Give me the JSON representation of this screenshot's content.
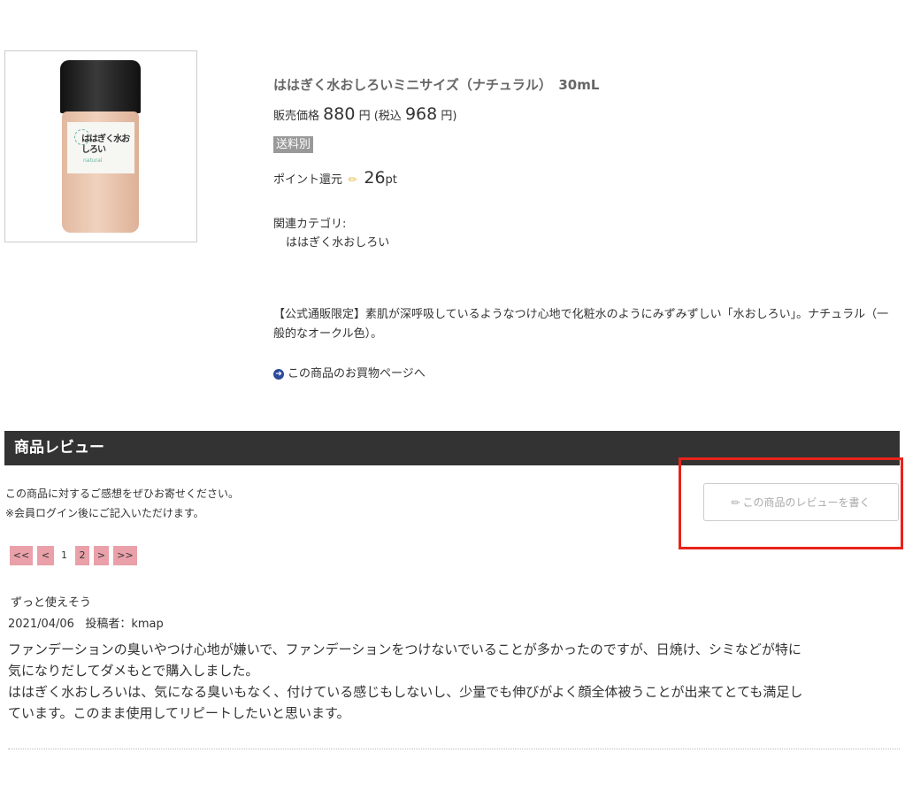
{
  "product": {
    "title": "ははぎく水おしろいミニサイズ（ナチュラル）　30mL",
    "price_label": "販売価格",
    "price": "880",
    "price_unit": "円",
    "tax_label": "(税込",
    "tax_price": "968",
    "tax_unit": "円)",
    "shipping_badge": "送料別",
    "point_label": "ポイント還元",
    "point_value": "26",
    "point_unit": "pt",
    "category_label": "関連カテゴリ:",
    "category_item": "ははぎく水おしろい",
    "description": "【公式通販限定】素肌が深呼吸しているようなつけ心地で化粧水のようにみずみずしい「水おしろい」。ナチュラル（一般的なオークル色）。",
    "buy_link": "この商品のお買物ページへ",
    "image_label_main": "ははぎく水おしろい",
    "image_label_sub": "natural"
  },
  "reviews": {
    "heading": "商品レビュー",
    "note_line1": "この商品に対するご感想をぜひお寄せください。",
    "note_line2": "※会員ログイン後にご記入いただけます。",
    "write_button": "この商品のレビューを書く",
    "pager": {
      "first": "<<",
      "prev": "<",
      "page1": "1",
      "page2": "2",
      "next": ">",
      "last": ">>"
    },
    "items": [
      {
        "title": "ずっと使えそう",
        "date": "2021/04/06",
        "author_label": "投稿者：",
        "author": "kmap",
        "body1": "ファンデーションの臭いやつけ心地が嫌いで、ファンデーションをつけないでいることが多かったのですが、日焼け、シミなどが特に気になりだしてダメもとで購入しました。",
        "body2": "ははぎく水おしろいは、気になる臭いもなく、付けている感じもしないし、少量でも伸びがよく顔全体被うことが出来てとても満足しています。このまま使用してリピートしたいと思います。"
      }
    ]
  },
  "colors": {
    "header_bg": "#333333",
    "pager_bg": "#e9a0a8",
    "highlight": "#e8231b",
    "badge_bg": "#999999"
  }
}
